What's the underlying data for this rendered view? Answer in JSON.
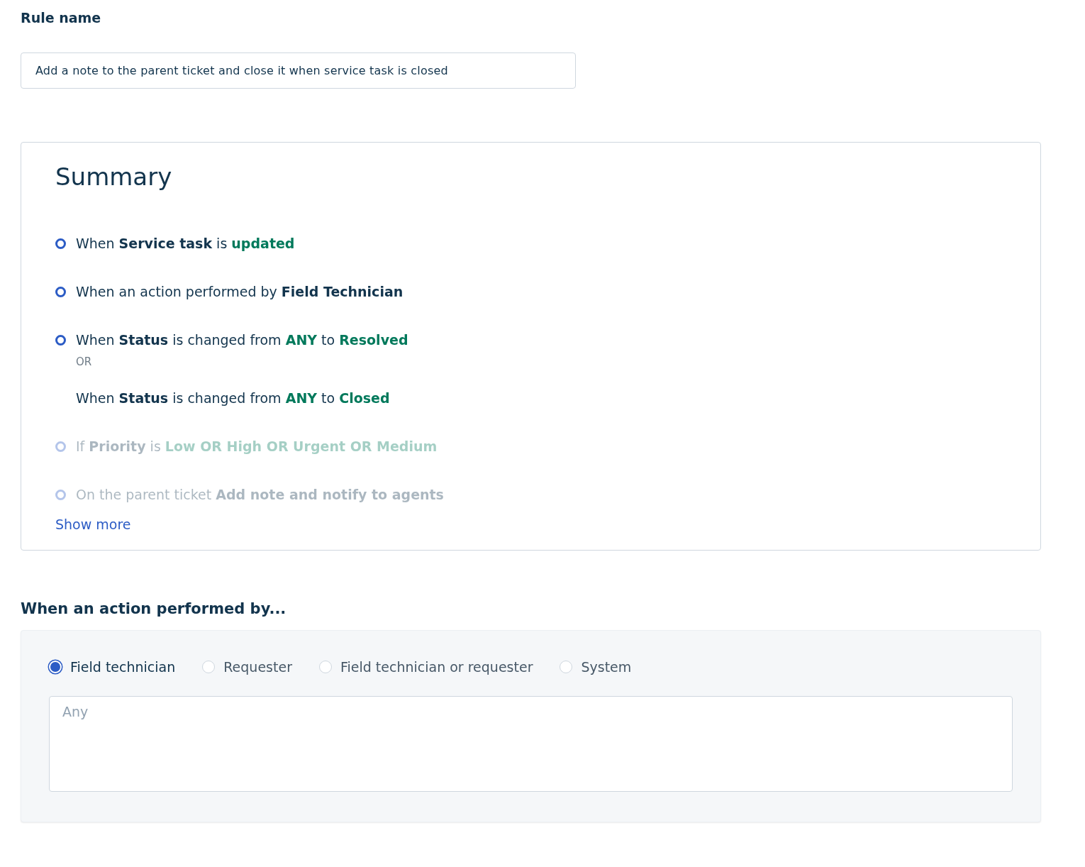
{
  "rule_name": {
    "label": "Rule name",
    "value": "Add a note to the parent ticket and close it when service task is closed"
  },
  "summary": {
    "title": "Summary",
    "items": [
      {
        "bullet": true,
        "faded": false,
        "parts": [
          {
            "kind": "plain",
            "text": "When"
          },
          {
            "kind": "field",
            "text": "Service task"
          },
          {
            "kind": "plain",
            "text": "is"
          },
          {
            "kind": "value",
            "text": "updated"
          }
        ]
      },
      {
        "bullet": true,
        "faded": false,
        "parts": [
          {
            "kind": "plain",
            "text": "When an action performed by"
          },
          {
            "kind": "field",
            "text": "Field Technician"
          }
        ]
      },
      {
        "bullet": true,
        "faded": false,
        "parts": [
          {
            "kind": "plain",
            "text": "When"
          },
          {
            "kind": "field",
            "text": "Status"
          },
          {
            "kind": "plain",
            "text": "is changed from"
          },
          {
            "kind": "value",
            "text": "ANY"
          },
          {
            "kind": "plain",
            "text": "to"
          },
          {
            "kind": "value",
            "text": "Resolved"
          }
        ]
      },
      {
        "bullet": false,
        "faded": false,
        "kind": "separator",
        "parts": [
          {
            "kind": "plain",
            "text": "OR"
          }
        ]
      },
      {
        "bullet": false,
        "faded": false,
        "parts": [
          {
            "kind": "plain",
            "text": "When"
          },
          {
            "kind": "field",
            "text": "Status"
          },
          {
            "kind": "plain",
            "text": "is changed from"
          },
          {
            "kind": "value",
            "text": "ANY"
          },
          {
            "kind": "plain",
            "text": "to"
          },
          {
            "kind": "value",
            "text": "Closed"
          }
        ]
      },
      {
        "bullet": true,
        "faded": true,
        "parts": [
          {
            "kind": "plain",
            "text": "If"
          },
          {
            "kind": "field",
            "text": "Priority"
          },
          {
            "kind": "plain",
            "text": "is"
          },
          {
            "kind": "value",
            "text": "Low OR High OR Urgent OR Medium"
          }
        ]
      },
      {
        "bullet": true,
        "faded": true,
        "parts": [
          {
            "kind": "plain",
            "text": "On the parent ticket"
          },
          {
            "kind": "field",
            "text": "Add note and notify to agents"
          }
        ]
      }
    ],
    "show_more": "Show more"
  },
  "performer": {
    "heading": "When an action performed by...",
    "options": [
      {
        "label": "Field technician",
        "selected": true
      },
      {
        "label": "Requester",
        "selected": false
      },
      {
        "label": "Field technician or requester",
        "selected": false
      },
      {
        "label": "System",
        "selected": false
      }
    ],
    "placeholder": "Any"
  }
}
